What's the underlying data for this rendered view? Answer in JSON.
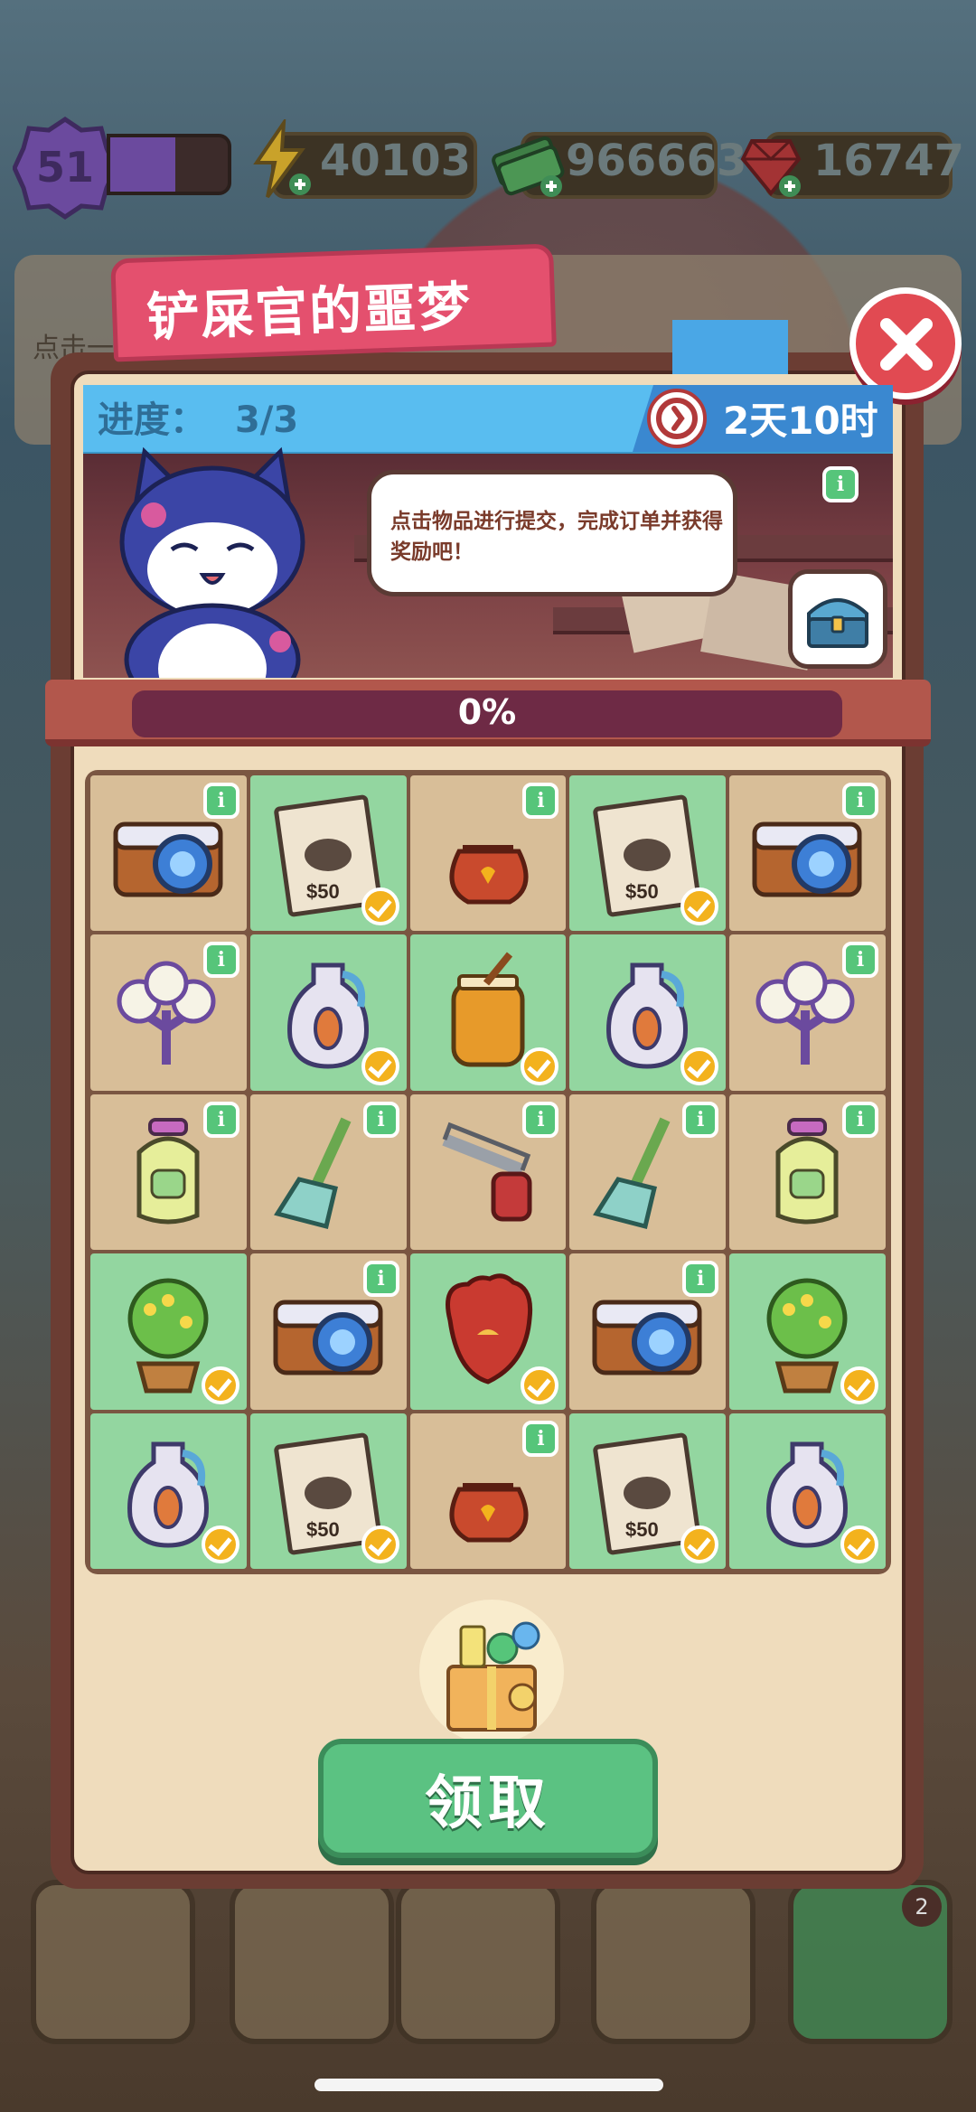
{
  "hud": {
    "level": "51",
    "xp_progress": 0.55,
    "energy": "40103",
    "cash": "966663",
    "gems": "16747"
  },
  "background": {
    "hint": "点击一"
  },
  "dialog": {
    "title": "铲屎官的噩梦",
    "progress_label": "进度：",
    "progress_value": "3/3",
    "timer": "2天10时",
    "bubble_text": "点击物品进行提交，完成订单并获得奖励吧！",
    "progress_percent_text": "0%",
    "progress_fraction": 0.0,
    "claim_label": "领取"
  },
  "bottom_bar": {
    "badge_count": "2"
  },
  "grid": {
    "cells": [
      {
        "item": "camera-icon",
        "bg": "tan",
        "info": true,
        "check": false
      },
      {
        "item": "wanted-poster-icon",
        "bg": "green",
        "info": false,
        "check": true
      },
      {
        "item": "pouch-icon",
        "bg": "tan",
        "info": true,
        "check": false
      },
      {
        "item": "wanted-poster-icon",
        "bg": "green",
        "info": false,
        "check": true
      },
      {
        "item": "camera-icon",
        "bg": "tan",
        "info": true,
        "check": false
      },
      {
        "item": "cotton-plant-icon",
        "bg": "tan",
        "info": true,
        "check": false
      },
      {
        "item": "vase-icon",
        "bg": "green",
        "info": false,
        "check": true
      },
      {
        "item": "honey-jar-icon",
        "bg": "green",
        "info": false,
        "check": true
      },
      {
        "item": "vase-icon",
        "bg": "green",
        "info": false,
        "check": true
      },
      {
        "item": "cotton-plant-icon",
        "bg": "tan",
        "info": true,
        "check": false
      },
      {
        "item": "soap-bottle-icon",
        "bg": "tan",
        "info": true,
        "check": false
      },
      {
        "item": "broom-icon",
        "bg": "tan",
        "info": true,
        "check": false
      },
      {
        "item": "hacksaw-icon",
        "bg": "tan",
        "info": true,
        "check": false
      },
      {
        "item": "broom-icon",
        "bg": "tan",
        "info": true,
        "check": false
      },
      {
        "item": "soap-bottle-icon",
        "bg": "tan",
        "info": true,
        "check": false
      },
      {
        "item": "potted-tree-icon",
        "bg": "green",
        "info": false,
        "check": true
      },
      {
        "item": "camera-icon",
        "bg": "tan",
        "info": true,
        "check": false
      },
      {
        "item": "glove-icon",
        "bg": "green",
        "info": false,
        "check": true
      },
      {
        "item": "camera-icon",
        "bg": "tan",
        "info": true,
        "check": false
      },
      {
        "item": "potted-tree-icon",
        "bg": "green",
        "info": false,
        "check": true
      },
      {
        "item": "vase-icon",
        "bg": "green",
        "info": false,
        "check": true
      },
      {
        "item": "wanted-poster-icon",
        "bg": "green",
        "info": false,
        "check": true
      },
      {
        "item": "pouch-icon",
        "bg": "tan",
        "info": true,
        "check": false
      },
      {
        "item": "wanted-poster-icon",
        "bg": "green",
        "info": false,
        "check": true
      },
      {
        "item": "vase-icon",
        "bg": "green",
        "info": false,
        "check": true
      }
    ]
  },
  "colors": {
    "accent_pink": "#e4506e",
    "header_blue": "#59bdf0",
    "claim_green": "#5bc282",
    "cell_green": "#93d6a0",
    "cell_tan": "#d8be98"
  }
}
